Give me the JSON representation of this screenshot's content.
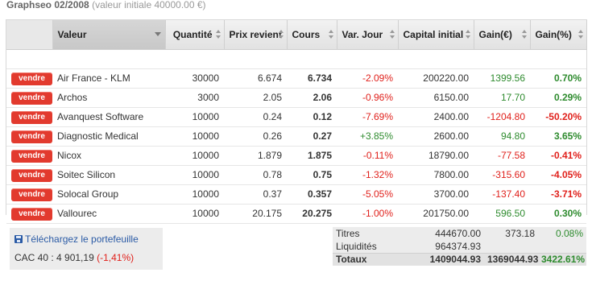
{
  "header": {
    "title": "Graphseo 02/2008",
    "subtitle": "(valeur initiale 40000.00 €)"
  },
  "table": {
    "columns": [
      "Valeur",
      "Quantité",
      "Prix revient",
      "Cours",
      "Var. Jour",
      "Capital initial",
      "Gain(€)",
      "Gain(%)"
    ],
    "sell_label": "vendre",
    "rows": [
      {
        "name": "Air France - KLM",
        "qty": "30000",
        "cost": "6.674",
        "price": "6.734",
        "var": "-2.09%",
        "capital": "200220.00",
        "gain": "1399.56",
        "gain_pct": "0.70%",
        "var_dir": "neg",
        "gain_dir": "pos"
      },
      {
        "name": "Archos",
        "qty": "3000",
        "cost": "2.05",
        "price": "2.06",
        "var": "-0.96%",
        "capital": "6150.00",
        "gain": "17.70",
        "gain_pct": "0.29%",
        "var_dir": "neg",
        "gain_dir": "pos"
      },
      {
        "name": "Avanquest Software",
        "qty": "10000",
        "cost": "0.24",
        "price": "0.12",
        "var": "-7.69%",
        "capital": "2400.00",
        "gain": "-1204.80",
        "gain_pct": "-50.20%",
        "var_dir": "neg",
        "gain_dir": "neg"
      },
      {
        "name": "Diagnostic Medical",
        "qty": "10000",
        "cost": "0.26",
        "price": "0.27",
        "var": "+3.85%",
        "capital": "2600.00",
        "gain": "94.80",
        "gain_pct": "3.65%",
        "var_dir": "pos",
        "gain_dir": "pos"
      },
      {
        "name": "Nicox",
        "qty": "10000",
        "cost": "1.879",
        "price": "1.875",
        "var": "-0.11%",
        "capital": "18790.00",
        "gain": "-77.58",
        "gain_pct": "-0.41%",
        "var_dir": "neg",
        "gain_dir": "neg"
      },
      {
        "name": "Soitec Silicon",
        "qty": "10000",
        "cost": "0.78",
        "price": "0.75",
        "var": "-1.32%",
        "capital": "7800.00",
        "gain": "-315.60",
        "gain_pct": "-4.05%",
        "var_dir": "neg",
        "gain_dir": "neg"
      },
      {
        "name": "Solocal Group",
        "qty": "10000",
        "cost": "0.37",
        "price": "0.357",
        "var": "-5.05%",
        "capital": "3700.00",
        "gain": "-137.40",
        "gain_pct": "-3.71%",
        "var_dir": "neg",
        "gain_dir": "neg"
      },
      {
        "name": "Vallourec",
        "qty": "10000",
        "cost": "20.175",
        "price": "20.275",
        "var": "-1.00%",
        "capital": "201750.00",
        "gain": "596.50",
        "gain_pct": "0.30%",
        "var_dir": "neg",
        "gain_dir": "pos"
      }
    ]
  },
  "download": {
    "label": "Téléchargez le portefeuille",
    "icon": "floppy-disk-icon",
    "cac_label": "CAC 40 :",
    "cac_value": "4 901,19",
    "cac_change": "(-1,41%)"
  },
  "totals": {
    "titres_label": "Titres",
    "titres_capital": "444670.00",
    "titres_gain": "373.18",
    "titres_pct": "0.08%",
    "liquidites_label": "Liquidités",
    "liquidites_value": "964374.93",
    "total_label": "Totaux",
    "total_capital": "1409044.93",
    "total_gain": "1369044.93",
    "total_pct": "3422.61%"
  },
  "colors": {
    "sell_button": "#e23a2e",
    "negative": "#e0201b",
    "positive": "#2e8b2e",
    "link": "#2a5aa5"
  }
}
